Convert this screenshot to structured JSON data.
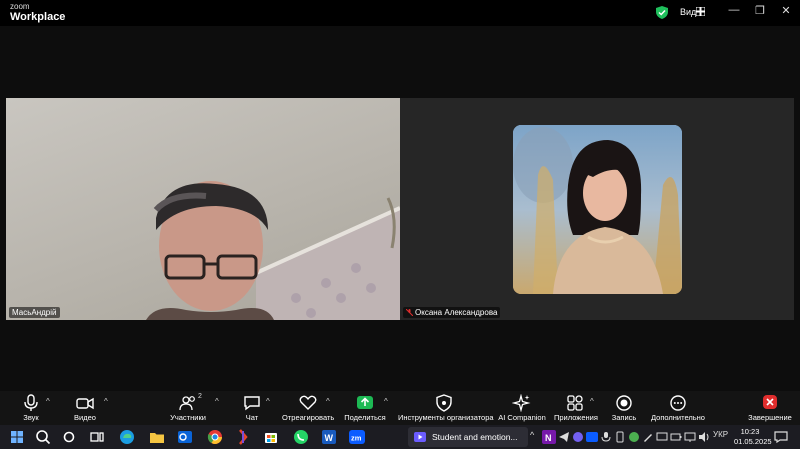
{
  "app": {
    "brand_small": "zoom",
    "brand_big": "Workplace"
  },
  "titlebar": {
    "view_label": "Вид",
    "view_icon": "grid-icon",
    "minimize": "—",
    "restore": "❐",
    "close": "✕"
  },
  "participants": [
    {
      "name": "МасьАндрій"
    },
    {
      "name": "Оксана Александрова",
      "muted": true
    }
  ],
  "toolbar": {
    "audio": "Звук",
    "video": "Видео",
    "participants": "Участники",
    "participants_count": "2",
    "chat": "Чат",
    "react": "Отреагировать",
    "share": "Поделиться",
    "host_tools": "Инструменты организатора",
    "ai": "AI Companion",
    "apps": "Приложения",
    "record": "Запись",
    "more": "Дополнительно",
    "end": "Завершение"
  },
  "taskbar": {
    "active_app_title": "Student and emotion...",
    "lang": "УКР",
    "time": "10:23",
    "date": "01.05.2025"
  },
  "colors": {
    "accent_green": "#1fbf5c",
    "share_green": "#1db954",
    "end_red": "#e02d2d",
    "zoom_blue": "#0b5cff"
  }
}
